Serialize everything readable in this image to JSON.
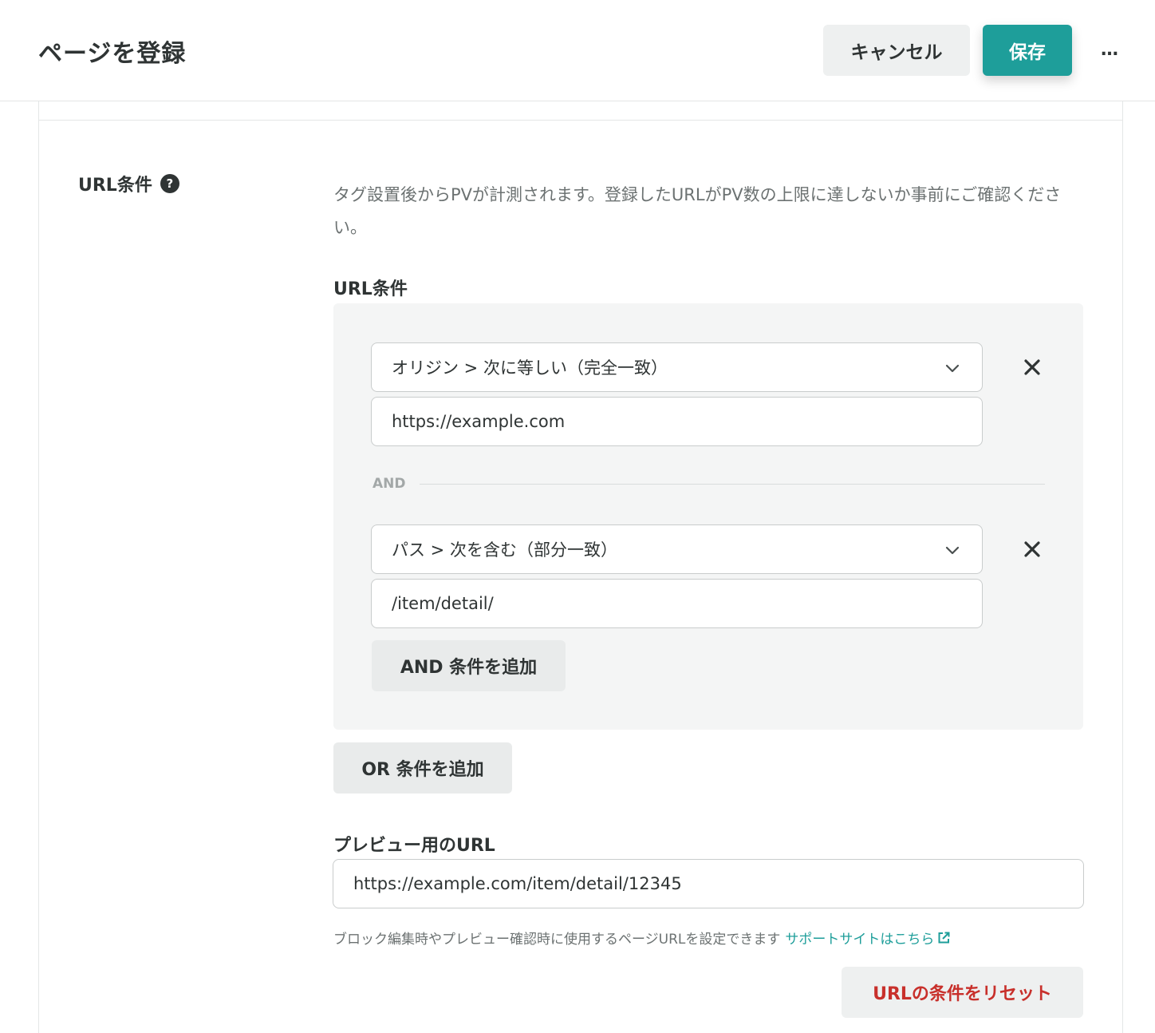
{
  "header": {
    "title": "ページを登録",
    "cancel_label": "キャンセル",
    "save_label": "保存",
    "more_icon": "…"
  },
  "url_section": {
    "label": "URL条件",
    "help_icon": "?",
    "description": "タグ設置後からPVが計測されます。登録したURLがPV数の上限に達しないか事前にご確認ください。",
    "conditions_label": "URL条件",
    "conditions": [
      {
        "select": "オリジン > 次に等しい（完全一致）",
        "value": "https://example.com"
      },
      {
        "select": "パス > 次を含む（部分一致）",
        "value": "/item/detail/"
      }
    ],
    "and_separator": "AND",
    "add_and_label": "AND 条件を追加",
    "add_or_label": "OR 条件を追加"
  },
  "preview": {
    "label": "プレビュー用のURL",
    "value": "https://example.com/item/detail/12345",
    "help_text": "ブロック編集時やプレビュー確認時に使用するページURLを設定できます",
    "support_link": "サポートサイトはこちら"
  },
  "reset_label": "URLの条件をリセット",
  "colors": {
    "accent": "#1e9e9a",
    "danger": "#c8302b",
    "muted": "#6c7272"
  }
}
